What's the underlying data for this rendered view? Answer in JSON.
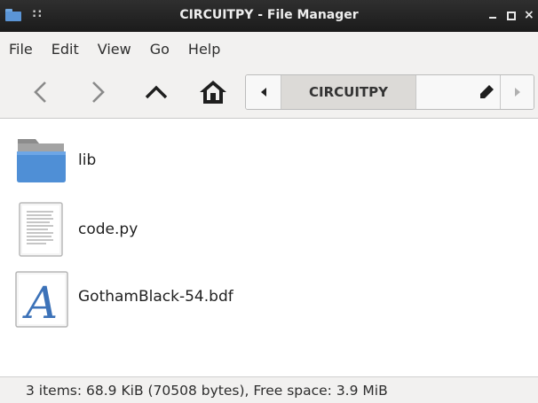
{
  "window": {
    "title": "CIRCUITPY - File Manager",
    "grip": "::"
  },
  "titlebar_controls": {
    "close_glyph": "×"
  },
  "menu": {
    "items": [
      "File",
      "Edit",
      "View",
      "Go",
      "Help"
    ]
  },
  "toolbar": {
    "back_icon": "chevron-left-icon",
    "forward_icon": "chevron-right-icon",
    "up_icon": "chevron-up-icon",
    "home_icon": "home-icon"
  },
  "pathbar": {
    "current": "CIRCUITPY",
    "edit_icon": "pencil-icon"
  },
  "files": [
    {
      "name": "lib",
      "icon": "folder-icon"
    },
    {
      "name": "code.py",
      "icon": "text-file-icon"
    },
    {
      "name": "GothamBlack-54.bdf",
      "icon": "font-file-icon",
      "glyph": "A"
    }
  ],
  "statusbar": {
    "text": "3 items: 68.9 KiB (70508 bytes), Free space: 3.9 MiB"
  },
  "colors": {
    "titlebar_bg": "#1b1b1b",
    "chrome_bg": "#f2f1f0",
    "folder_blue": "#4f8fd6",
    "font_glyph_blue": "#3c72b8",
    "active_crumb_bg": "#dcdad7"
  }
}
